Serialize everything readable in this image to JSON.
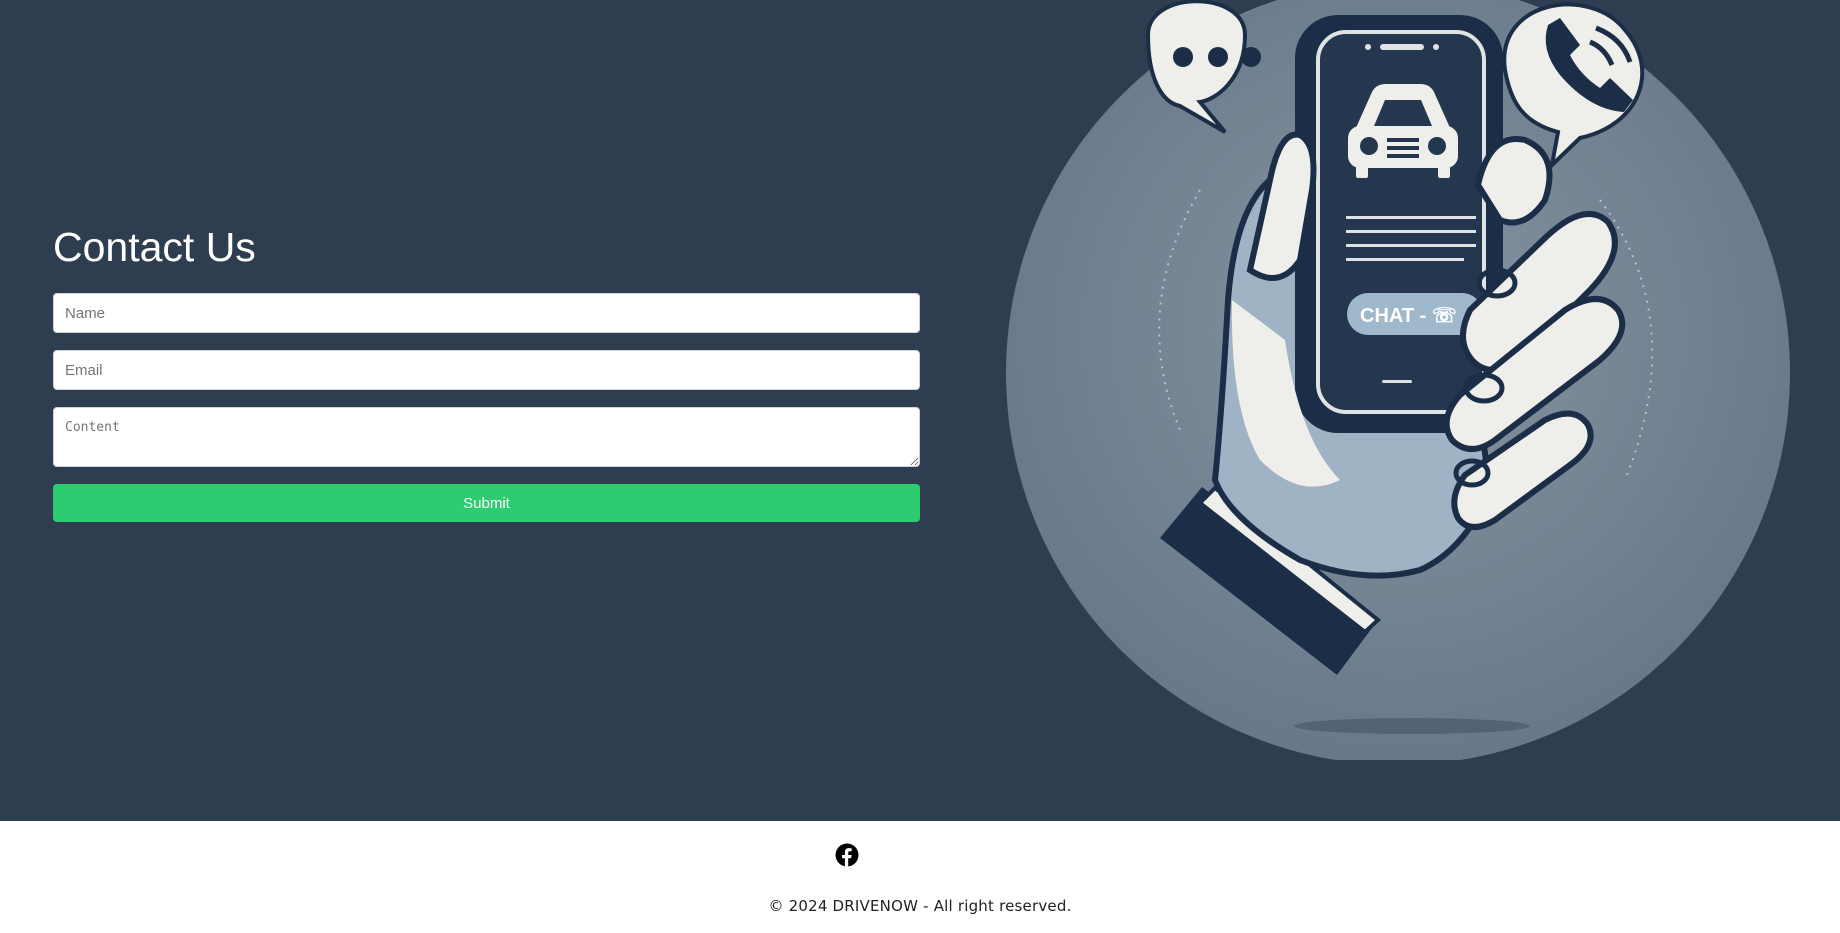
{
  "contact": {
    "title": "Contact Us",
    "name_placeholder": "Name",
    "email_placeholder": "Email",
    "content_placeholder": "Content",
    "name_value": "",
    "email_value": "",
    "content_value": "",
    "submit_label": "Submit"
  },
  "illustration": {
    "phone_badge": "CHAT - ☏",
    "icons": [
      "chat-bubble-icon",
      "phone-call-icon",
      "car-icon"
    ]
  },
  "footer": {
    "social_icon": "facebook-icon",
    "copyright": "© 2024 DRIVENOW - All right reserved."
  },
  "colors": {
    "hero_bg": "#2e3e50",
    "submit_bg": "#2ecc71",
    "footer_bg": "#ffffff"
  }
}
